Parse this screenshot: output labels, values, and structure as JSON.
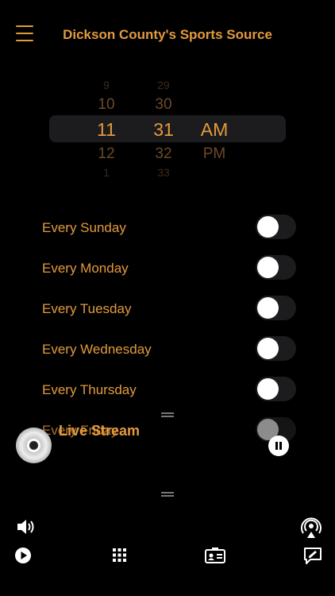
{
  "header": {
    "title": "Dickson County's Sports Source",
    "menu_icon": "hamburger-icon"
  },
  "picker": {
    "hours": [
      "9",
      "10",
      "11",
      "12",
      "1"
    ],
    "minutes": [
      "29",
      "30",
      "31",
      "32",
      "33"
    ],
    "periods": [
      "AM",
      "PM"
    ],
    "selected": {
      "hour": "11",
      "minute": "31",
      "period": "AM"
    }
  },
  "days": [
    {
      "label": "Every Sunday",
      "on": false
    },
    {
      "label": "Every Monday",
      "on": false
    },
    {
      "label": "Every Tuesday",
      "on": false
    },
    {
      "label": "Every Wednesday",
      "on": false
    },
    {
      "label": "Every Thursday",
      "on": false
    },
    {
      "label": "Every Friday",
      "on": false
    }
  ],
  "player": {
    "title": "Live Stream",
    "state": "playing"
  },
  "toolbar": {
    "icons": [
      "volume-icon",
      "airplay-icon",
      "play-icon",
      "grid-icon",
      "contact-card-icon",
      "compose-icon"
    ]
  },
  "colors": {
    "accent": "#e39a3d",
    "background": "#000000",
    "toggle_track": "#1c1c1e"
  }
}
